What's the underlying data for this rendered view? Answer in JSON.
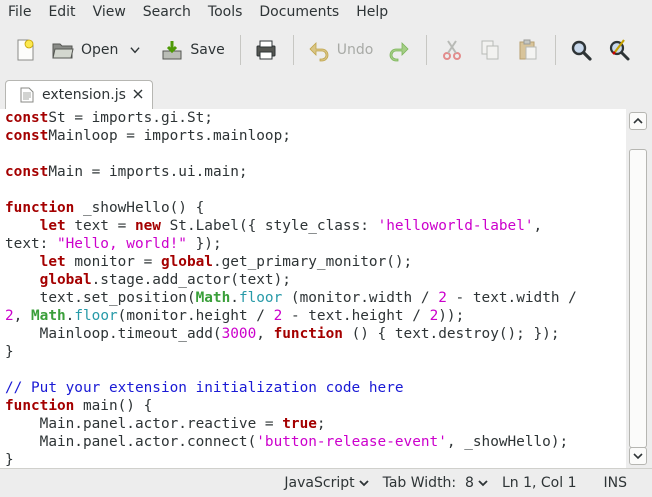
{
  "menubar": {
    "items": [
      "File",
      "Edit",
      "View",
      "Search",
      "Tools",
      "Documents",
      "Help"
    ]
  },
  "toolbar": {
    "open_label": "Open",
    "save_label": "Save",
    "undo_label": "Undo"
  },
  "tab": {
    "filename": "extension.js"
  },
  "editor": {
    "lines": [
      [
        [
          "kw",
          "const"
        ],
        [
          "",
          "St = imports.gi.St;"
        ]
      ],
      [
        [
          "kw",
          "const"
        ],
        [
          "",
          "Mainloop = imports.mainloop;"
        ]
      ],
      [],
      [
        [
          "kw",
          "const"
        ],
        [
          "",
          "Main = imports.ui.main;"
        ]
      ],
      [],
      [
        [
          "kw",
          "function"
        ],
        [
          "",
          " _showHello() {"
        ]
      ],
      [
        [
          "",
          "    "
        ],
        [
          "kw",
          "let"
        ],
        [
          "",
          " text = "
        ],
        [
          "kw",
          "new"
        ],
        [
          "",
          " St.Label({ style_class: "
        ],
        [
          "str",
          "'helloworld-label'"
        ],
        [
          "",
          ","
        ]
      ],
      [
        [
          "",
          "text: "
        ],
        [
          "str",
          "\"Hello, world!\""
        ],
        [
          "",
          " });"
        ]
      ],
      [
        [
          "",
          "    "
        ],
        [
          "kw",
          "let"
        ],
        [
          "",
          " monitor = "
        ],
        [
          "kw",
          "global"
        ],
        [
          "",
          ".get_primary_monitor();"
        ]
      ],
      [
        [
          "",
          "    "
        ],
        [
          "kw",
          "global"
        ],
        [
          "",
          ".stage.add_actor(text);"
        ]
      ],
      [
        [
          "",
          "    text.set_position("
        ],
        [
          "bi",
          "Math"
        ],
        [
          "",
          "."
        ],
        [
          "bi2",
          "floor"
        ],
        [
          "",
          " (monitor.width / "
        ],
        [
          "num",
          "2"
        ],
        [
          "",
          " - text.width /"
        ]
      ],
      [
        [
          "num",
          "2"
        ],
        [
          "",
          ", "
        ],
        [
          "bi",
          "Math"
        ],
        [
          "",
          "."
        ],
        [
          "bi2",
          "floor"
        ],
        [
          "",
          "(monitor.height / "
        ],
        [
          "num",
          "2"
        ],
        [
          "",
          " - text.height / "
        ],
        [
          "num",
          "2"
        ],
        [
          "",
          "));"
        ]
      ],
      [
        [
          "",
          "    Mainloop.timeout_add("
        ],
        [
          "num",
          "3000"
        ],
        [
          "",
          ", "
        ],
        [
          "kw",
          "function"
        ],
        [
          "",
          " () { text.destroy(); });"
        ]
      ],
      [
        [
          "",
          "}"
        ]
      ],
      [],
      [
        [
          "cmt",
          "// Put your extension initialization code here"
        ]
      ],
      [
        [
          "kw",
          "function"
        ],
        [
          "",
          " main() {"
        ]
      ],
      [
        [
          "",
          "    Main.panel.actor.reactive = "
        ],
        [
          "kw",
          "true"
        ],
        [
          "",
          ";"
        ]
      ],
      [
        [
          "",
          "    Main.panel.actor.connect("
        ],
        [
          "str",
          "'button-release-event'"
        ],
        [
          "",
          ", _showHello);"
        ]
      ],
      [
        [
          "",
          "}"
        ]
      ]
    ]
  },
  "statusbar": {
    "language": "JavaScript",
    "tab_width": "Tab Width:  8",
    "position": "Ln 1, Col 1",
    "mode": "INS"
  },
  "colors": {
    "keyword": "#a40000",
    "string": "#cc00cc",
    "comment": "#1a1ad5",
    "builtin": "#3a9f3a"
  }
}
